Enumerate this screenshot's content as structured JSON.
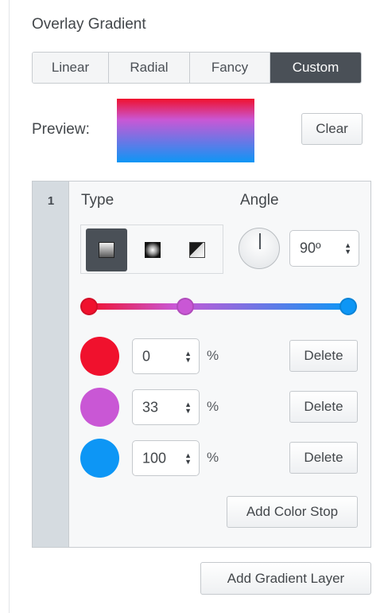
{
  "panel": {
    "title": "Overlay Gradient"
  },
  "tabs": [
    {
      "label": "Linear",
      "active": false
    },
    {
      "label": "Radial",
      "active": false
    },
    {
      "label": "Fancy",
      "active": false
    },
    {
      "label": "Custom",
      "active": true
    }
  ],
  "preview": {
    "label": "Preview:",
    "clear_label": "Clear"
  },
  "layer": {
    "index": "1",
    "type_label": "Type",
    "angle_label": "Angle",
    "angle_value": "90º",
    "type_options": [
      "linear-gradient-icon",
      "radial-gradient-icon",
      "fancy-gradient-icon"
    ],
    "stops": [
      {
        "color": "#f0112d",
        "position": "0",
        "unit": "%",
        "delete_label": "Delete"
      },
      {
        "color": "#c957d5",
        "position": "33",
        "unit": "%",
        "delete_label": "Delete"
      },
      {
        "color": "#0d96f5",
        "position": "100",
        "unit": "%",
        "delete_label": "Delete"
      }
    ],
    "add_stop_label": "Add Color Stop"
  },
  "add_layer_label": "Add Gradient Layer"
}
